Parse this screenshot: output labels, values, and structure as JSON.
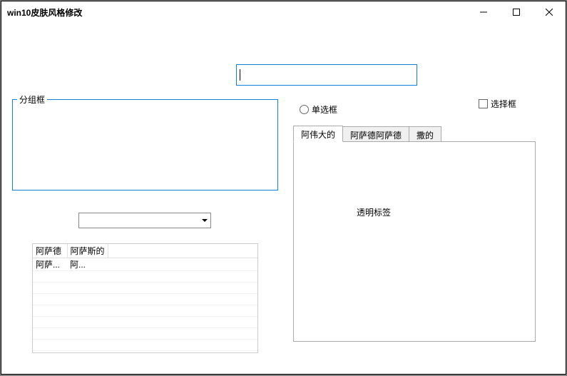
{
  "window": {
    "title": "win10皮肤风格修改"
  },
  "groupbox": {
    "legend": "分组框"
  },
  "textfield": {
    "value": ""
  },
  "radio": {
    "label": "单选框",
    "checked": false
  },
  "checkbox": {
    "label": "选择框",
    "checked": false
  },
  "tabs": {
    "items": [
      {
        "label": "阿伟大的",
        "active": true
      },
      {
        "label": "阿萨德阿萨德",
        "active": false
      },
      {
        "label": "撒的",
        "active": false
      }
    ],
    "page": {
      "label": "透明标签"
    }
  },
  "combo": {
    "value": ""
  },
  "table": {
    "columns": [
      "阿萨德",
      "阿萨斯的"
    ],
    "rows": [
      [
        "阿萨...",
        "阿..."
      ]
    ]
  }
}
